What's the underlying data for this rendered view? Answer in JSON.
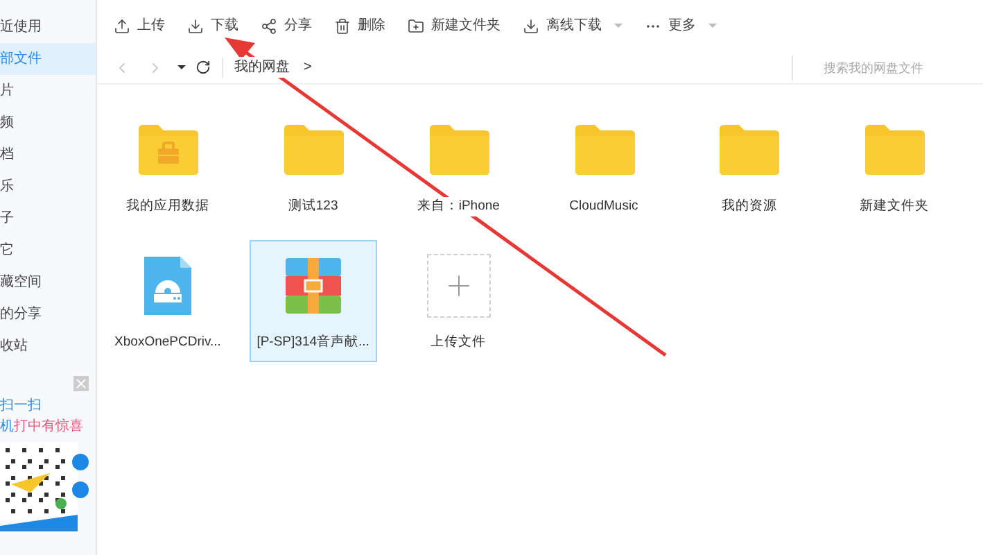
{
  "sidebar": {
    "items": [
      {
        "label": "近使用",
        "selected": false
      },
      {
        "label": "部文件",
        "selected": true
      },
      {
        "label": "片",
        "selected": false
      },
      {
        "label": "频",
        "selected": false
      },
      {
        "label": "档",
        "selected": false
      },
      {
        "label": "乐",
        "selected": false
      },
      {
        "label": "子",
        "selected": false
      },
      {
        "label": "它",
        "selected": false
      },
      {
        "label": "藏空间",
        "selected": false
      },
      {
        "label": "的分享",
        "selected": false
      },
      {
        "label": "收站",
        "selected": false
      }
    ],
    "promo": {
      "line1": "扫一扫",
      "line2_a": "机",
      "line2_b": "打中有惊喜"
    }
  },
  "toolbar": [
    {
      "kind": "upload",
      "label": "上传",
      "dropdown": false
    },
    {
      "kind": "download",
      "label": "下载",
      "dropdown": false
    },
    {
      "kind": "share",
      "label": "分享",
      "dropdown": false
    },
    {
      "kind": "delete",
      "label": "删除",
      "dropdown": false
    },
    {
      "kind": "new-folder",
      "label": "新建文件夹",
      "dropdown": false
    },
    {
      "kind": "offline",
      "label": "离线下载",
      "dropdown": true
    },
    {
      "kind": "more",
      "label": "更多",
      "dropdown": true
    }
  ],
  "breadcrumb": {
    "path": "我的网盘",
    "separator": ">"
  },
  "search": {
    "placeholder": "搜索我的网盘文件"
  },
  "files": [
    {
      "kind": "app-folder",
      "name": "我的应用数据",
      "selected": false
    },
    {
      "kind": "folder",
      "name": "测试123",
      "selected": false
    },
    {
      "kind": "folder",
      "name": "来自：iPhone",
      "selected": false
    },
    {
      "kind": "folder",
      "name": "CloudMusic",
      "selected": false
    },
    {
      "kind": "folder",
      "name": "我的资源",
      "selected": false
    },
    {
      "kind": "folder",
      "name": "新建文件夹",
      "selected": false
    },
    {
      "kind": "disk-file",
      "name": "XboxOnePCDriv...",
      "selected": false
    },
    {
      "kind": "archive",
      "name": "[P-SP]314音声献...",
      "selected": true
    },
    {
      "kind": "upload",
      "name": "上传文件",
      "selected": false
    }
  ]
}
